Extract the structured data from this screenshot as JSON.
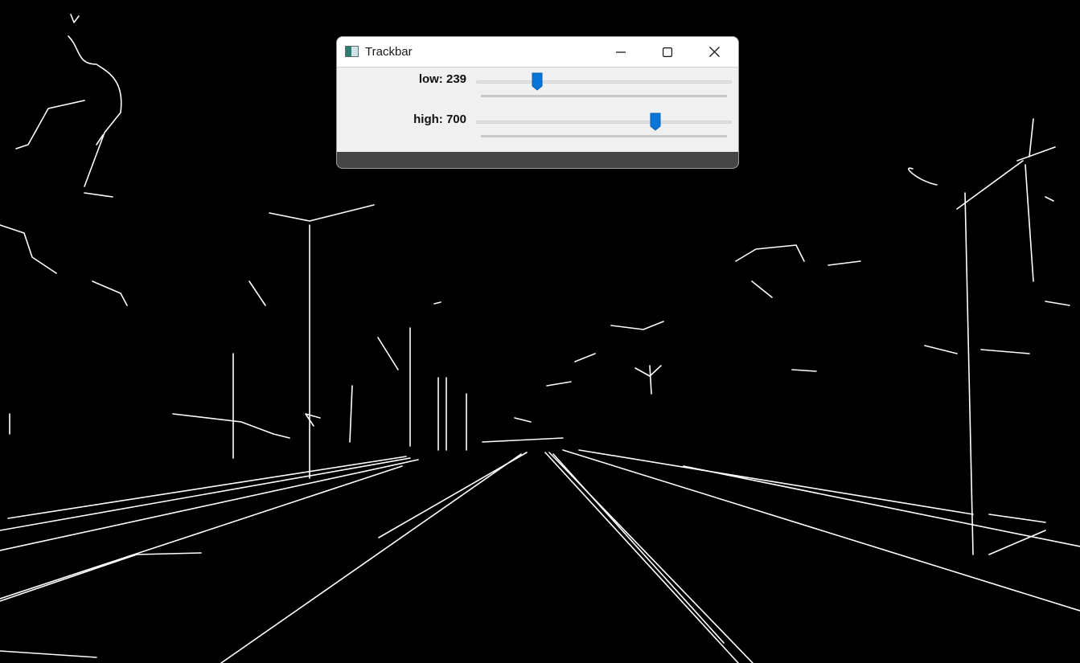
{
  "window": {
    "title": "Trackbar",
    "icon": "app-image-icon",
    "controls": [
      "minimize-icon",
      "maximize-icon",
      "close-icon"
    ]
  },
  "trackbars": {
    "low": {
      "label": "low: 239",
      "value": 239,
      "max": 1000
    },
    "high": {
      "label": "high: 700",
      "value": 700,
      "max": 1000
    }
  },
  "colors": {
    "thumb": "#0a76d8",
    "background": "#000000",
    "edges": "#ffffff",
    "dialog": "#f0f0f0"
  }
}
